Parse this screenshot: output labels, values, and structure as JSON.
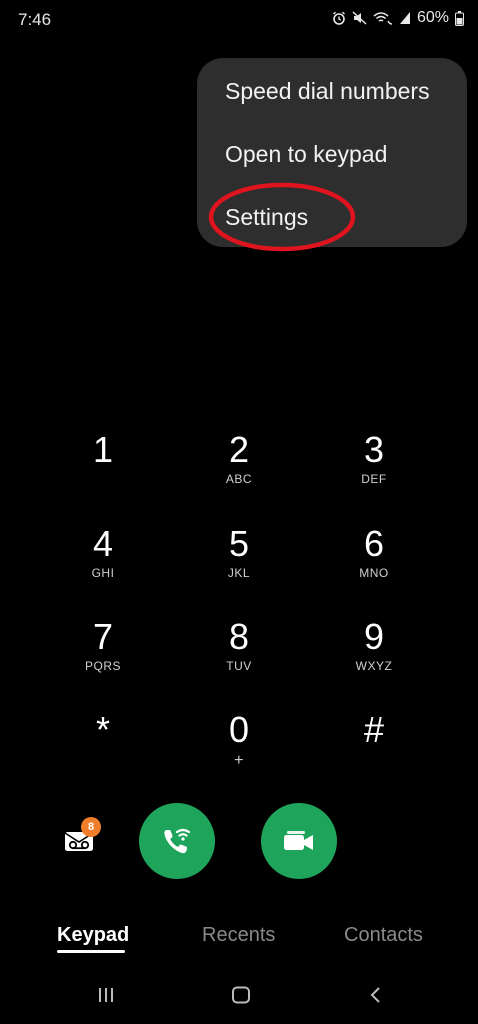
{
  "status_bar": {
    "time": "7:46",
    "battery": "60%",
    "icons": [
      "alarm-icon",
      "mute-icon",
      "wifi-calling-icon",
      "signal-icon",
      "battery-icon"
    ]
  },
  "menu": {
    "items": [
      {
        "label": "Speed dial numbers"
      },
      {
        "label": "Open to keypad"
      },
      {
        "label": "Settings"
      }
    ],
    "highlight_color": "#e0141e"
  },
  "keypad": {
    "keys": [
      {
        "digit": "1",
        "letters": ""
      },
      {
        "digit": "2",
        "letters": "ABC"
      },
      {
        "digit": "3",
        "letters": "DEF"
      },
      {
        "digit": "4",
        "letters": "GHI"
      },
      {
        "digit": "5",
        "letters": "JKL"
      },
      {
        "digit": "6",
        "letters": "MNO"
      },
      {
        "digit": "7",
        "letters": "PQRS"
      },
      {
        "digit": "8",
        "letters": "TUV"
      },
      {
        "digit": "9",
        "letters": "WXYZ"
      },
      {
        "digit": "*",
        "letters": ""
      },
      {
        "digit": "0",
        "letters": "+"
      },
      {
        "digit": "#",
        "letters": ""
      }
    ]
  },
  "actions": {
    "voicemail_badge": "8",
    "call_color": "#1fa55b",
    "badge_color": "#f07d2a"
  },
  "tabs": [
    {
      "label": "Keypad",
      "active": true
    },
    {
      "label": "Recents",
      "active": false
    },
    {
      "label": "Contacts",
      "active": false
    }
  ]
}
